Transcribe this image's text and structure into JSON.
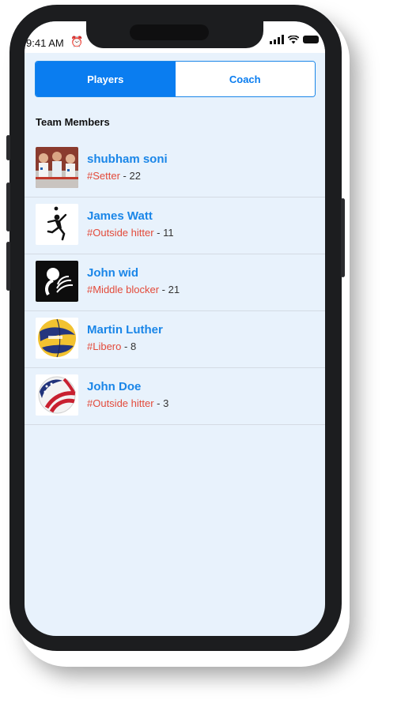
{
  "status_bar": {
    "time": "9:41 AM",
    "alarm_icon": "alarm-clock-icon"
  },
  "tabs": [
    {
      "label": "Players",
      "active": true
    },
    {
      "label": "Coach",
      "active": false
    }
  ],
  "section_title": "Team Members",
  "players": [
    {
      "name": "shubham soni",
      "tag": "#Setter",
      "number": "22",
      "avatar": "team-photo"
    },
    {
      "name": "James Watt",
      "tag": "#Outside hitter",
      "number": "11",
      "avatar": "silhouette-spiker"
    },
    {
      "name": "John wid",
      "tag": "#Middle blocker",
      "number": "21",
      "avatar": "volleyball-logo"
    },
    {
      "name": "Martin Luther",
      "tag": "#Libero",
      "number": "8",
      "avatar": "volleyball-blue-yellow"
    },
    {
      "name": "John Doe",
      "tag": "#Outside hitter",
      "number": "3",
      "avatar": "volleyball-usa"
    }
  ],
  "colors": {
    "accent": "#0a7df0",
    "tag": "#e34a3a",
    "background": "#e8f2fc"
  }
}
